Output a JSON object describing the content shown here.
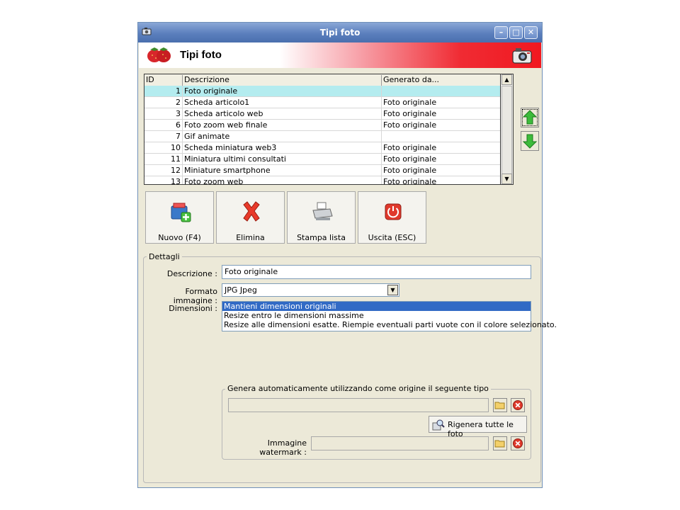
{
  "window": {
    "title": "Tipi foto",
    "controls": [
      "minimize-icon",
      "maximize-icon",
      "close-icon"
    ]
  },
  "banner": {
    "title": "Tipi foto"
  },
  "grid": {
    "columns": [
      "ID",
      "Descrizione",
      "Generato da..."
    ],
    "rows": [
      {
        "id": "1",
        "desc": "Foto originale",
        "gen": ""
      },
      {
        "id": "2",
        "desc": "Scheda articolo1",
        "gen": "Foto originale"
      },
      {
        "id": "3",
        "desc": "Scheda articolo web",
        "gen": "Foto originale"
      },
      {
        "id": "6",
        "desc": "Foto zoom web finale",
        "gen": "Foto originale"
      },
      {
        "id": "7",
        "desc": "Gif animate",
        "gen": ""
      },
      {
        "id": "10",
        "desc": "Scheda miniatura web3",
        "gen": "Foto originale"
      },
      {
        "id": "11",
        "desc": "Miniatura ultimi consultati",
        "gen": "Foto originale"
      },
      {
        "id": "12",
        "desc": "Miniature smartphone",
        "gen": "Foto originale"
      },
      {
        "id": "13",
        "desc": "Foto zoom web",
        "gen": "Foto originale"
      }
    ],
    "selected_row": 0
  },
  "toolbar": {
    "new_label": "Nuovo (F4)",
    "delete_label": "Elimina",
    "print_label": "Stampa lista",
    "exit_label": "Uscita (ESC)"
  },
  "details": {
    "legend": "Dettagli",
    "descrizione_label": "Descrizione :",
    "descrizione_value": "Foto originale",
    "formato_label": "Formato immagine :",
    "formato_value": "JPG Jpeg",
    "dimensioni_label": "Dimensioni :",
    "dimensioni_options": [
      "Mantieni dimensioni originali",
      "Resize entro le dimensioni massime",
      "Resize alle dimensioni esatte. Riempie eventuali parti vuote con il colore selezionato."
    ],
    "dimensioni_selected": 0
  },
  "auto": {
    "legend": "Genera automaticamente utilizzando come origine il seguente tipo",
    "source_value": "",
    "regen_label": "Rigenera tutte le foto",
    "watermark_label": "Immagine watermark :",
    "watermark_value": ""
  },
  "colors": {
    "title_bar": "#5b7fbd",
    "banner_red": "#f11820",
    "selected_row": "#b4ecef",
    "list_selection": "#316ac5"
  }
}
